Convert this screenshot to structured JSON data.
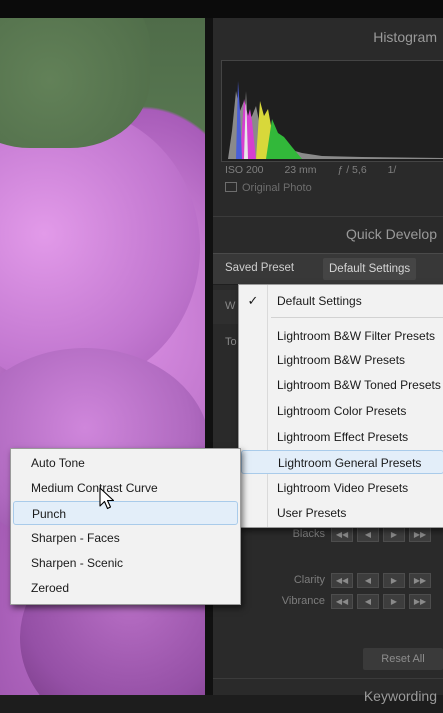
{
  "photo": {
    "alt": "pink-flower-photo"
  },
  "panel": {
    "histogram_title": "Histogram",
    "exif": {
      "iso": "ISO 200",
      "focal": "23 mm",
      "aperture": "ƒ / 5,6",
      "shutter": "1/"
    },
    "original_photo": "Original Photo",
    "quick_develop_title": "Quick Develop",
    "saved_preset_label": "Saved Preset",
    "saved_preset_value": "Default Settings",
    "wb_partial": "W",
    "tone_partial": "To",
    "sliders": [
      {
        "name": "Blacks"
      },
      {
        "name": "Clarity"
      },
      {
        "name": "Vibrance"
      }
    ],
    "reset_all": "Reset All",
    "keywording_title": "Keywording"
  },
  "preset_menu": {
    "selected": "Default Settings",
    "check": "✓",
    "items": [
      "Default Settings",
      "Lightroom B&W Filter Presets",
      "Lightroom B&W Presets",
      "Lightroom B&W Toned Presets",
      "Lightroom Color Presets",
      "Lightroom Effect Presets",
      "Lightroom General Presets",
      "Lightroom Video Presets",
      "User Presets"
    ],
    "highlighted": "Lightroom General Presets"
  },
  "submenu": {
    "items": [
      "Auto Tone",
      "Medium Contrast Curve",
      "Punch",
      "Sharpen - Faces",
      "Sharpen - Scenic",
      "Zeroed"
    ],
    "highlighted": "Punch"
  },
  "colors": {
    "panel_bg": "#2a2a2a",
    "menu_bg": "#f2f2f2",
    "highlight": "#e3eef9"
  }
}
